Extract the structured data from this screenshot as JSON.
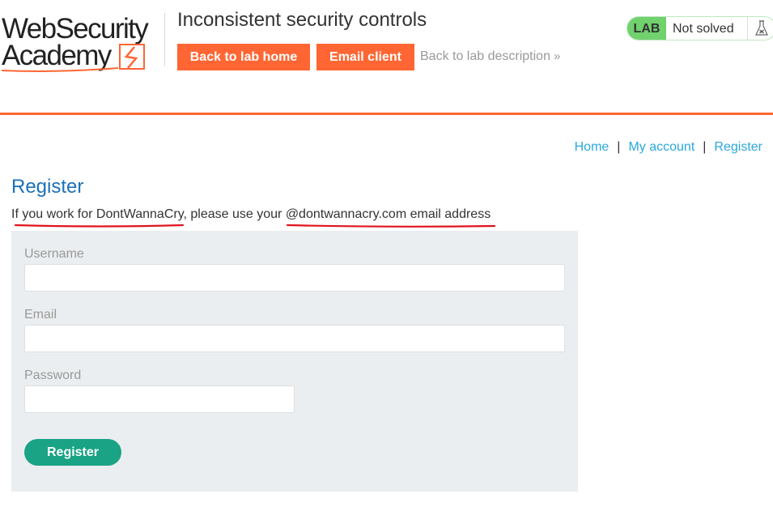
{
  "header": {
    "logo_line1": "WebSecurity",
    "logo_line2": "Academy",
    "lab_title": "Inconsistent security controls",
    "back_to_lab_home": "Back to lab home",
    "email_client": "Email client",
    "back_to_description": "Back to lab description",
    "status": {
      "tag": "LAB",
      "state": "Not solved",
      "tag_color": "#70d16d"
    },
    "accent_color": "#ff6633"
  },
  "nav": {
    "home": "Home",
    "separator": "|",
    "my_account": "My account",
    "register": "Register"
  },
  "main": {
    "title": "Register",
    "hint_part1": "If you work for DontWannaCry",
    "hint_part2": ", please use your ",
    "hint_part3": "@dontwannacry.com email address",
    "form": {
      "username_label": "Username",
      "username_value": "",
      "email_label": "Email",
      "email_value": "",
      "password_label": "Password",
      "password_value": "",
      "submit_label": "Register",
      "submit_color": "#1aa385"
    }
  },
  "annotations": {
    "underline_color": "#e0141e"
  }
}
